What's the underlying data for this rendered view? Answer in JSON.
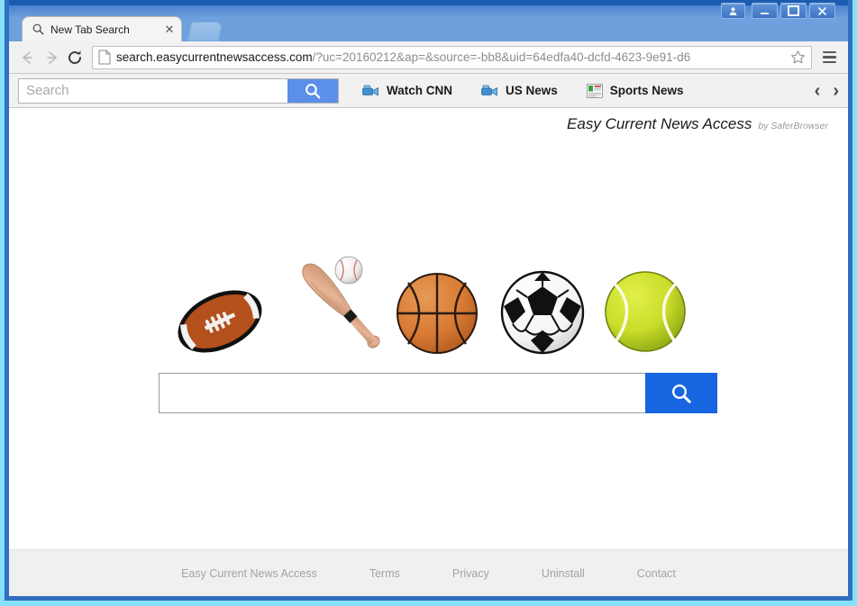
{
  "window": {
    "controls": [
      {
        "name": "user-account",
        "glyph": "☻"
      },
      {
        "name": "minimize",
        "glyph": "–"
      },
      {
        "name": "maximize",
        "glyph": "□"
      },
      {
        "name": "close",
        "glyph": "✕"
      }
    ]
  },
  "tab": {
    "title": "New Tab Search",
    "favicon": "search-icon",
    "close_glyph": "✕"
  },
  "navbar": {
    "back_icon": "back-arrow-icon",
    "forward_icon": "forward-arrow-icon",
    "reload_icon": "reload-icon",
    "page_icon": "page-document-icon",
    "url_host": "search.easycurrentnewsaccess.com",
    "url_query": "/?uc=20160212&ap=&source=-bb8&uid=64edfa40-dcfd-4623-9e91-d6",
    "star_icon": "bookmark-star-icon",
    "menu_icon": "hamburger-menu-icon"
  },
  "toolbar": {
    "search_placeholder": "Search",
    "search_value": "",
    "search_button_icon": "search-icon",
    "links": [
      {
        "label": "Watch CNN",
        "icon": "video-camera-icon"
      },
      {
        "label": "US News",
        "icon": "video-camera-icon"
      },
      {
        "label": "Sports News",
        "icon": "newspaper-icon"
      }
    ],
    "prev_glyph": "‹",
    "next_glyph": "›"
  },
  "brand": {
    "name": "Easy Current News Access",
    "by": "by SaferBrowser"
  },
  "hero": {
    "balls": [
      {
        "name": "football",
        "label": "Football"
      },
      {
        "name": "baseball-bat-and-ball",
        "label": "Baseball bat and ball"
      },
      {
        "name": "basketball",
        "label": "Basketball"
      },
      {
        "name": "soccer-ball",
        "label": "Soccer ball"
      },
      {
        "name": "tennis-ball",
        "label": "Tennis ball"
      }
    ]
  },
  "search": {
    "value": "",
    "placeholder": "",
    "button_icon": "search-icon"
  },
  "footer": {
    "links": [
      "Easy Current News Access",
      "Terms",
      "Privacy",
      "Uninstall",
      "Contact"
    ]
  },
  "colors": {
    "titlebar_blue": "#4a82cf",
    "toolbar_search_button": "#5b8fe8",
    "main_search_button": "#1765e0",
    "window_border_cyan": "#86e0f7",
    "footer_bg": "#f0f0f0",
    "football_brown": "#b4501c",
    "basketball_orange": "#d87a33",
    "tennis_yellow": "#c9dd2a"
  }
}
